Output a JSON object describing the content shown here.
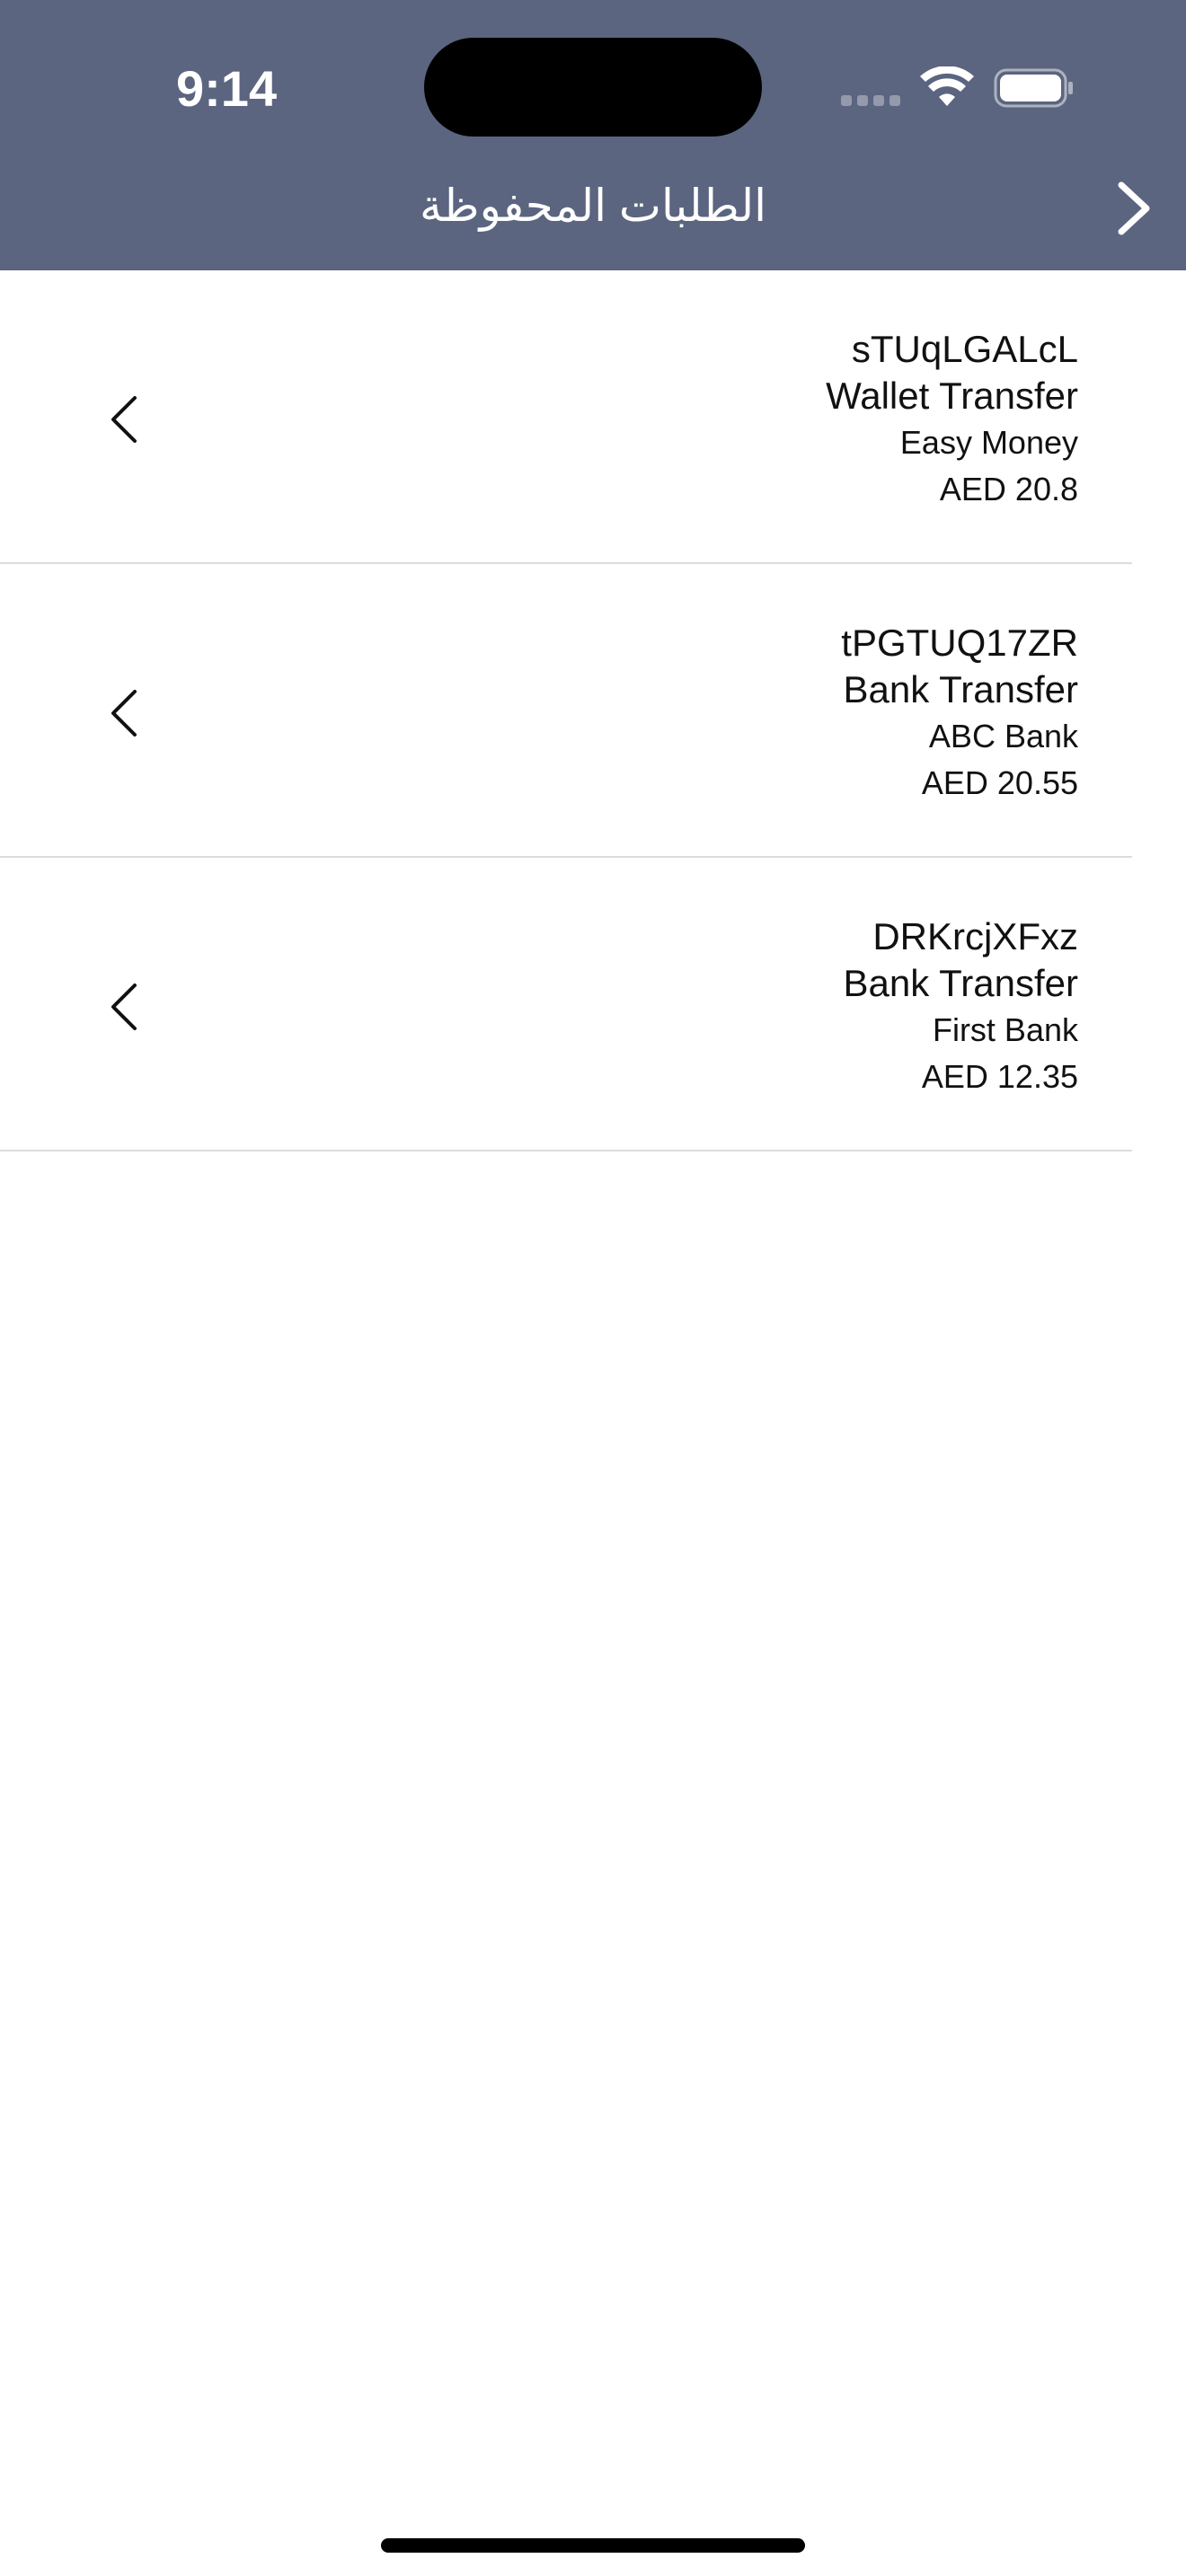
{
  "status_bar": {
    "time": "9:14"
  },
  "nav": {
    "title": "الطلبات المحفوظة",
    "back_icon": "chevron-right-icon",
    "background_color": "#5b6580"
  },
  "requests": [
    {
      "reference": "sTUqLGALcL",
      "type": "Wallet Transfer",
      "provider": "Easy Money",
      "amount": "AED 20.8"
    },
    {
      "reference": "tPGTUQ17ZR",
      "type": "Bank Transfer",
      "provider": "ABC Bank",
      "amount": "AED 20.55"
    },
    {
      "reference": "DRKrcjXFxz",
      "type": "Bank Transfer",
      "provider": "First Bank",
      "amount": "AED 12.35"
    }
  ]
}
